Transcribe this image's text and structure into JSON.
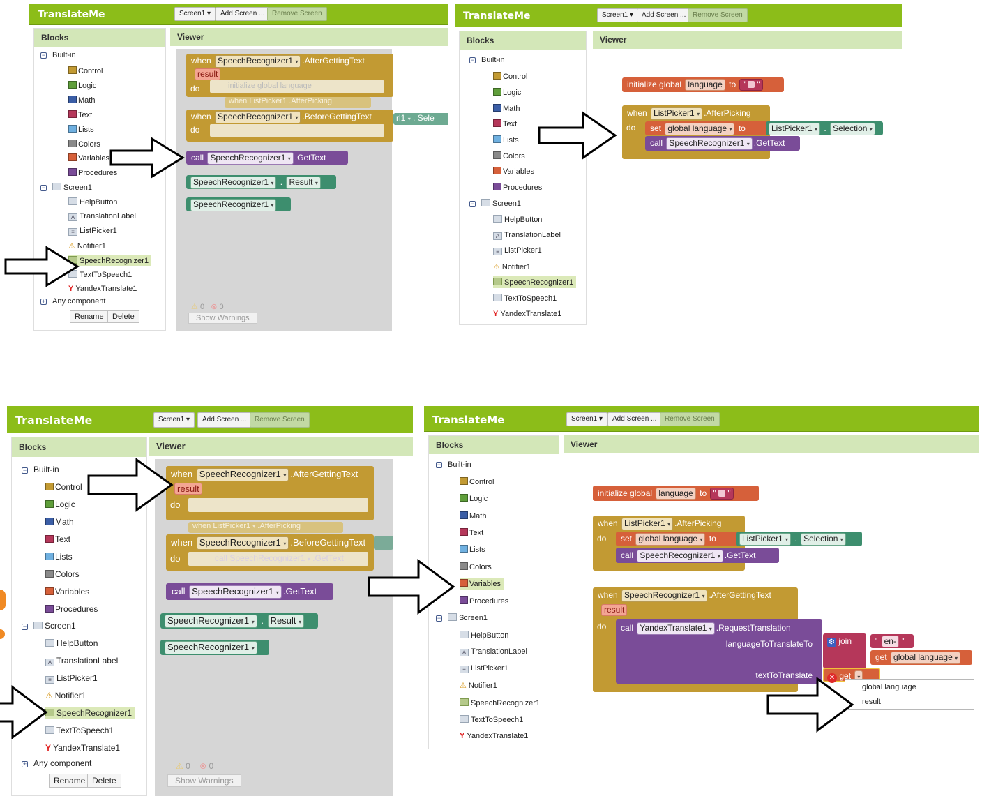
{
  "app": {
    "title": "TranslateMe",
    "screen_select": "Screen1",
    "add_screen": "Add Screen ...",
    "remove_screen": "Remove Screen",
    "blocks_header": "Blocks",
    "viewer_header": "Viewer"
  },
  "tree": {
    "built_in": "Built-in",
    "builtins": [
      "Control",
      "Logic",
      "Math",
      "Text",
      "Lists",
      "Colors",
      "Variables",
      "Procedures"
    ],
    "screen": "Screen1",
    "components": [
      "HelpButton",
      "TranslationLabel",
      "ListPicker1",
      "Notifier1",
      "SpeechRecognizer1",
      "TextToSpeech1",
      "YandexTranslate1"
    ],
    "any_component": "Any component",
    "rename": "Rename",
    "delete": "Delete"
  },
  "colors": {
    "header_green": "#8cbd19",
    "control": "#c29a33",
    "logic": "#5f9e3a",
    "math": "#3b5ea6",
    "text": "#b5375a",
    "lists": "#6fb0e0",
    "colors": "#8a8a8a",
    "variables": "#d6603a",
    "procedures": "#7a4c98"
  },
  "blocks": {
    "when": "when",
    "do": "do",
    "call": "call",
    "set": "set",
    "to": "to",
    "get": "get",
    "join": "join",
    "result": "result",
    "speech": "SpeechRecognizer1",
    "after_text": ".AfterGettingText",
    "before_text": ".BeforeGettingText",
    "get_text": ".GetText",
    "result_prop": "Result",
    "listpicker": "ListPicker1",
    "after_picking": ".AfterPicking",
    "selection": "Selection",
    "init_global": "initialize global",
    "language": "language",
    "global_language": "global language",
    "yandex": "YandexTranslate1",
    "request": ".RequestTranslation",
    "lang_to": "languageToTranslateTo",
    "text_to": "textToTranslate",
    "en": "en-",
    "sele": "Sele",
    "dot": "."
  },
  "faded": {
    "init_global_language": "initialize global language",
    "when_lp": "when  ListPicker1",
    "after_picking": ".AfterPicking",
    "call_sr": "call  SpeechRecognizer1",
    "get_text": ".GetText",
    "rl1": "rl1"
  },
  "warnings": {
    "warn_count": "0",
    "error_count": "0",
    "button": "Show Warnings"
  },
  "menu": {
    "items": [
      "global language",
      "result"
    ]
  }
}
